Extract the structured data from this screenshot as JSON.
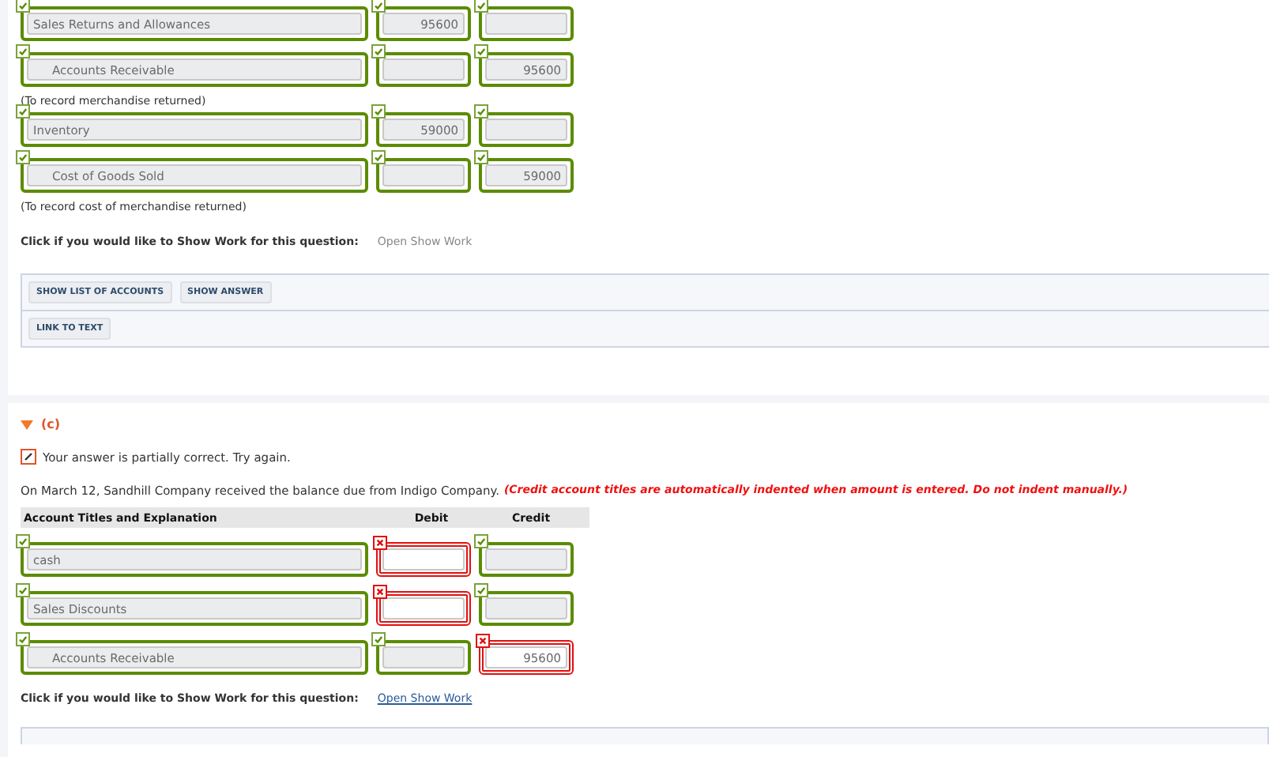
{
  "part_b": {
    "groups": [
      {
        "rows": [
          {
            "account": {
              "value": "Sales Returns and Allowances",
              "indented": false,
              "correct": true
            },
            "debit": {
              "value": "95600",
              "correct": true
            },
            "credit": {
              "correct": true
            }
          },
          {
            "account": {
              "value": "Accounts Receivable",
              "indented": true,
              "correct": true
            },
            "debit": {
              "correct": true
            },
            "credit": {
              "value": "95600",
              "correct": true
            }
          }
        ],
        "note": "(To record merchandise returned)"
      },
      {
        "rows": [
          {
            "account": {
              "value": "Inventory",
              "indented": false,
              "correct": true
            },
            "debit": {
              "value": "59000",
              "correct": true
            },
            "credit": {
              "correct": true
            }
          },
          {
            "account": {
              "value": "Cost of Goods Sold",
              "indented": true,
              "correct": true
            },
            "debit": {
              "correct": true
            },
            "credit": {
              "value": "59000",
              "correct": true
            }
          }
        ],
        "note": "(To record cost of merchandise returned)"
      }
    ],
    "show_work": {
      "prompt": "Click if you would like to Show Work for this question:",
      "link": "Open Show Work",
      "link_active": false
    },
    "toolbar": [
      [
        "SHOW LIST OF ACCOUNTS",
        "SHOW ANSWER"
      ],
      [
        "LINK TO TEXT"
      ]
    ]
  },
  "part_c": {
    "label": "(c)",
    "expanded": true,
    "feedback": "Your answer is partially correct.  Try again.",
    "question": "On March 12, Sandhill Company received the balance due from Indigo Company.",
    "instruction": "(Credit account titles are automatically indented when amount is entered. Do not indent manually.)",
    "columns": [
      "Account Titles and Explanation",
      "Debit",
      "Credit"
    ],
    "rows": [
      {
        "account": {
          "value": "cash",
          "indented": false,
          "correct": true
        },
        "debit": {
          "correct": false
        },
        "credit": {
          "correct": true
        }
      },
      {
        "account": {
          "value": "Sales Discounts",
          "indented": false,
          "correct": true
        },
        "debit": {
          "correct": false
        },
        "credit": {
          "correct": true
        }
      },
      {
        "account": {
          "value": "Accounts Receivable",
          "indented": true,
          "correct": true
        },
        "debit": {
          "correct": true
        },
        "credit": {
          "value": "95600",
          "correct": false
        }
      }
    ],
    "show_work": {
      "prompt": "Click if you would like to Show Work for this question:",
      "link": "Open Show Work",
      "link_active": true
    }
  }
}
